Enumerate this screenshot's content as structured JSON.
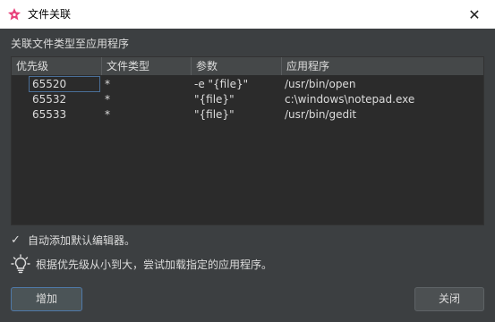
{
  "window": {
    "title": "文件关联",
    "close_glyph": "✕"
  },
  "section": {
    "label": "关联文件类型至应用程序"
  },
  "table": {
    "headers": [
      "优先级",
      "文件类型",
      "参数",
      "应用程序"
    ],
    "rows": [
      {
        "priority": "65520",
        "filetype": "*",
        "args": "-e \"{file}\"",
        "app": "/usr/bin/open"
      },
      {
        "priority": "65532",
        "filetype": "*",
        "args": "\"{file}\"",
        "app": "c:\\windows\\notepad.exe"
      },
      {
        "priority": "65533",
        "filetype": "*",
        "args": "\"{file}\"",
        "app": "/usr/bin/gedit"
      }
    ]
  },
  "auto_add": {
    "checked": true,
    "check_glyph": "✓",
    "label": "自动添加默认编辑器。"
  },
  "tip": {
    "icon": "lightbulb-icon",
    "text": "根据优先级从小到大，尝试加载指定的应用程序。"
  },
  "buttons": {
    "add": "增加",
    "close": "关闭"
  },
  "colors": {
    "background": "#3c3f41",
    "table_bg": "#2b2b2b",
    "accent": "#4f79a8",
    "app_icon": "#e8417a"
  }
}
